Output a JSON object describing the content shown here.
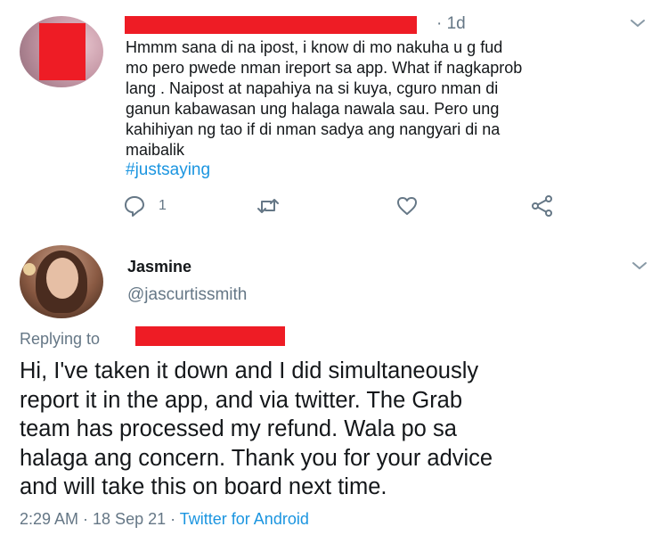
{
  "colors": {
    "text": "#14171a",
    "muted": "#657786",
    "link": "#1b95e0",
    "redaction": "#ee1c25"
  },
  "reply_tweet": {
    "time": "· 1d",
    "lines": [
      "Hmmm sana di na ipost,  i know di mo nakuha u g fud",
      "mo pero pwede nman ireport sa app. What if nagkaprob",
      "lang . Naipost at napahiya na si kuya, cguro nman di",
      "ganun kabawasan ung halaga nawala sau. Pero ung",
      "kahihiyan ng tao if di nman sadya ang nangyari di na",
      "maibalik"
    ],
    "hashtag": "#justsaying",
    "reply_count": "1",
    "icons": {
      "reply": "reply-icon",
      "retweet": "retweet-icon",
      "like": "heart-icon",
      "share": "share-icon",
      "menu": "chevron-down-icon"
    }
  },
  "main_tweet": {
    "name": "Jasmine",
    "handle": "@jascurtissmith",
    "replying_label": "Replying to",
    "lines": [
      "Hi, I've taken it down and I did simultaneously",
      "report it in the app, and via twitter. The Grab",
      "team has processed my refund. Wala po sa",
      "halaga ang concern. Thank you for your advice",
      "and will take this on board next time."
    ],
    "timestamp": "2:29 AM · 18 Sep 21 · ",
    "source": "Twitter for Android"
  }
}
